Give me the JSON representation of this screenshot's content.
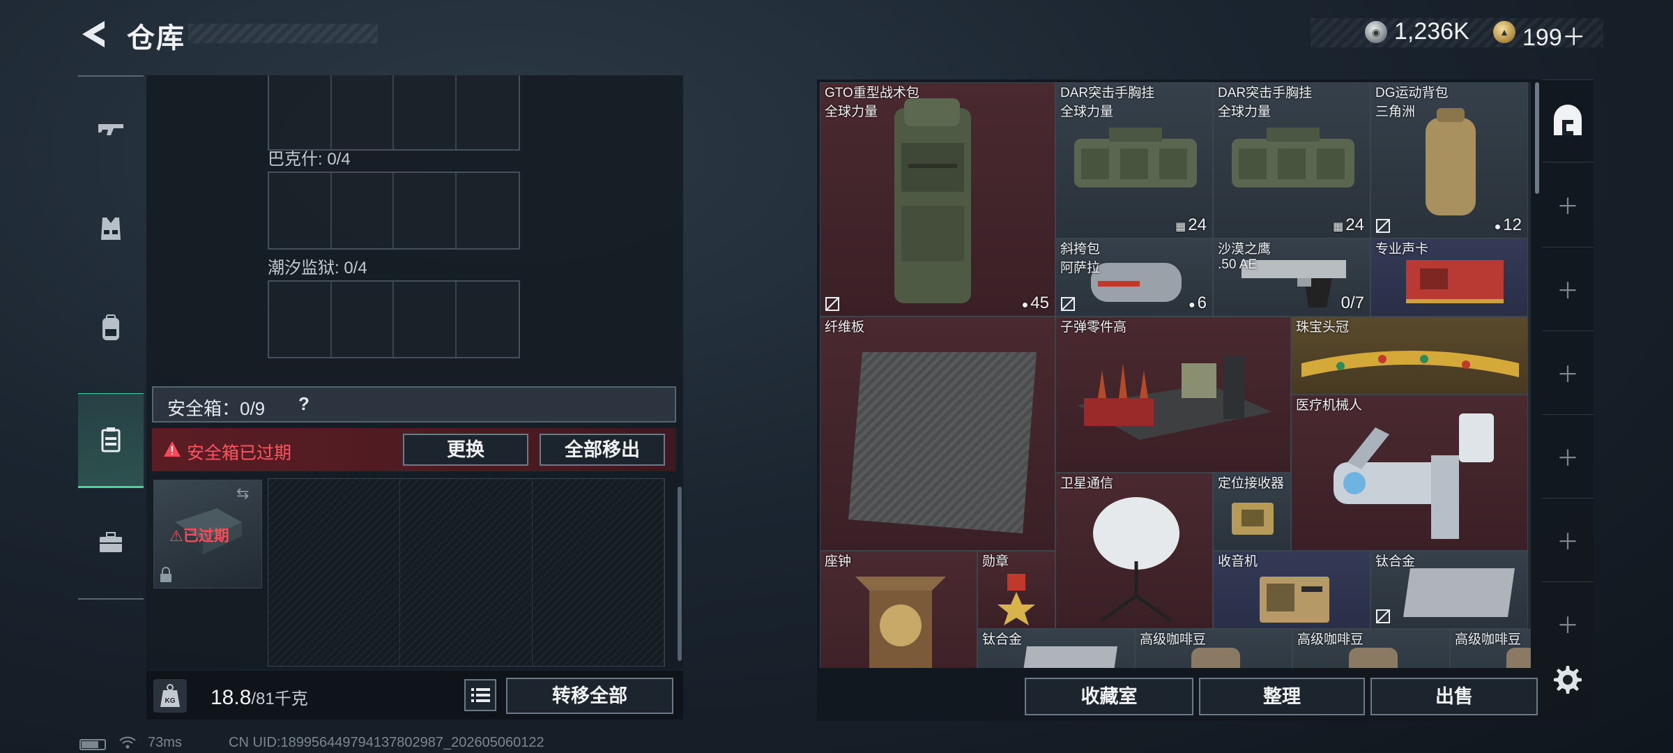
{
  "header": {
    "title": "仓库",
    "money": "1,236K",
    "tickets": "199＋",
    "back_icon": "back-arrow-icon"
  },
  "nav": [
    {
      "icon": "rifle-icon",
      "active": false
    },
    {
      "icon": "vest-icon",
      "active": false
    },
    {
      "icon": "backpack-icon",
      "active": false
    },
    {
      "icon": "safebox-icon",
      "active": true
    },
    {
      "icon": "briefcase-icon",
      "active": false
    }
  ],
  "storage": {
    "sections": [
      {
        "label": "巴克什: 0/4"
      },
      {
        "label": "潮汐监狱: 0/4"
      }
    ],
    "safebox_title": "安全箱：0/9",
    "safebox_help": "?",
    "expired_text": "安全箱已过期",
    "replace_label": "更换",
    "move_all_label": "全部移出",
    "safe_item_label": "已过期",
    "weight_value": "18.8",
    "weight_max": "/81千克",
    "transfer_all_label": "转移全部"
  },
  "status": {
    "ping": "73ms",
    "uid": "CN UID:18995644979413780298​7_202605060122"
  },
  "inventory": {
    "items": [
      {
        "name": "GTO重型战术包",
        "sub": "全球力量",
        "count": "45",
        "count_icon": "capacity-icon"
      },
      {
        "name": "DAR突击手胸挂",
        "sub": "全球力量",
        "count": "24",
        "count_icon": "vest-slot-icon"
      },
      {
        "name": "DAR突击手胸挂",
        "sub": "全球力量",
        "count": "24",
        "count_icon": "vest-slot-icon"
      },
      {
        "name": "DG运动背包",
        "sub": "三角洲",
        "count": "12",
        "count_icon": "capacity-icon"
      },
      {
        "name": "斜挎包",
        "sub": "阿萨拉",
        "count": "6",
        "count_icon": "capacity-icon"
      },
      {
        "name": "沙漠之鹰",
        "sub": ".50 AE",
        "count": "0/7"
      },
      {
        "name": "专业声卡",
        "sub": ""
      },
      {
        "name": "纤维板",
        "sub": ""
      },
      {
        "name": "子弹零件高",
        "sub": ""
      },
      {
        "name": "珠宝头冠",
        "sub": ""
      },
      {
        "name": "医疗机械人",
        "sub": ""
      },
      {
        "name": "卫星通信",
        "sub": ""
      },
      {
        "name": "定位接收器",
        "sub": ""
      },
      {
        "name": "座钟",
        "sub": ""
      },
      {
        "name": "勋章",
        "sub": ""
      },
      {
        "name": "收音机",
        "sub": ""
      },
      {
        "name": "钛合金",
        "sub": ""
      },
      {
        "name": "钛合金",
        "sub": ""
      },
      {
        "name": "高级咖啡豆",
        "sub": ""
      },
      {
        "name": "高级咖啡豆",
        "sub": ""
      },
      {
        "name": "高级咖啡豆",
        "sub": ""
      }
    ]
  },
  "actions": {
    "collection_label": "收藏室",
    "sort_label": "整理",
    "sell_label": "出售"
  },
  "right_tabs": [
    "home-icon",
    "add-icon",
    "add-icon",
    "add-icon",
    "add-icon",
    "add-icon",
    "add-icon"
  ]
}
